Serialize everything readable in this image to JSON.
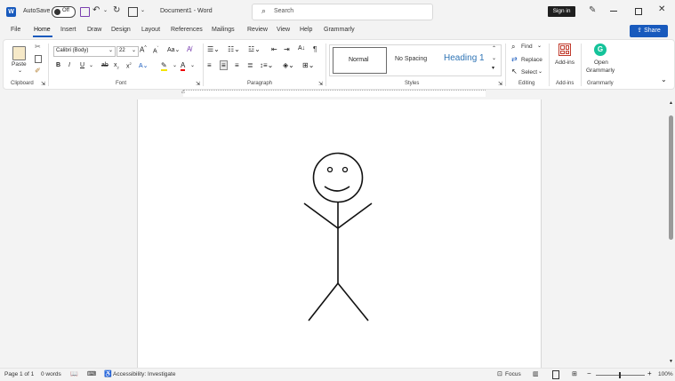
{
  "titlebar": {
    "autosave_label": "AutoSave",
    "autosave_state": "Off",
    "doc_title": "Document1 - Word",
    "search_placeholder": "Search",
    "signin_label": "Sign in"
  },
  "tabs": [
    "File",
    "Home",
    "Insert",
    "Draw",
    "Design",
    "Layout",
    "References",
    "Mailings",
    "Review",
    "View",
    "Help",
    "Grammarly"
  ],
  "active_tab": "Home",
  "share_label": "Share",
  "ribbon": {
    "clipboard": {
      "paste": "Paste",
      "label": "Clipboard"
    },
    "font": {
      "name": "Calibri (Body)",
      "size": "22",
      "label": "Font"
    },
    "paragraph": {
      "label": "Paragraph"
    },
    "styles": {
      "normal": "Normal",
      "nospacing": "No Spacing",
      "heading1": "Heading 1",
      "label": "Styles"
    },
    "editing": {
      "find": "Find",
      "replace": "Replace",
      "select": "Select",
      "label": "Editing"
    },
    "addins": {
      "button": "Add-ins",
      "label": "Add-ins"
    },
    "grammarly": {
      "open_line1": "Open",
      "open_line2": "Grammarly",
      "label": "Grammarly"
    }
  },
  "status": {
    "page": "Page 1 of 1",
    "words": "0 words",
    "accessibility": "Accessibility: Investigate",
    "focus": "Focus",
    "zoom": "100%"
  },
  "colors": {
    "accent": "#185abd",
    "grammarly": "#15c39a"
  }
}
